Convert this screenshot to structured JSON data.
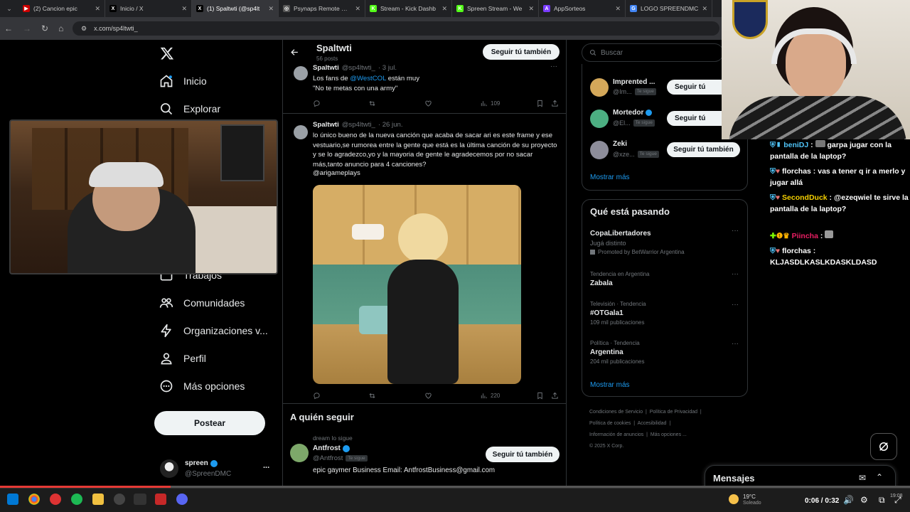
{
  "browser": {
    "tabs": [
      {
        "title": "(2) Cancion epic",
        "color": "#cc0000",
        "glyph": "▶"
      },
      {
        "title": "Inicio / X",
        "color": "#000000",
        "glyph": "X"
      },
      {
        "title": "(1) Spaltwti (@sp4lt",
        "color": "#000000",
        "glyph": "X"
      },
      {
        "title": "Psynaps Remote Con",
        "color": "#555555",
        "glyph": "◎"
      },
      {
        "title": "Stream - Kick Dashb",
        "color": "#53fc18",
        "glyph": "K"
      },
      {
        "title": "Spreen Stream - We",
        "color": "#53fc18",
        "glyph": "K"
      },
      {
        "title": "AppSorteos",
        "color": "#7a3cff",
        "glyph": "A"
      },
      {
        "title": "LOGO SPREENDMC",
        "color": "#4285f4",
        "glyph": "G"
      }
    ],
    "url": "x.com/sp4ltwti_"
  },
  "nav": {
    "items": [
      {
        "label": "Inicio",
        "icon": "home-icon"
      },
      {
        "label": "Explorar",
        "icon": "search-icon"
      },
      {
        "label": "Trabajos",
        "icon": "briefcase-icon"
      },
      {
        "label": "Comunidades",
        "icon": "communities-icon"
      },
      {
        "label": "Organizaciones v...",
        "icon": "lightning-icon"
      },
      {
        "label": "Perfil",
        "icon": "person-icon"
      },
      {
        "label": "Más opciones",
        "icon": "more-circle-icon"
      }
    ],
    "post_label": "Postear",
    "account": {
      "name": "spreen",
      "handle": "@SpreenDMC",
      "more": "..."
    }
  },
  "profile_header": {
    "name": "Spaltwti",
    "posts": "56 posts",
    "follow_label": "Seguir tú también"
  },
  "tweets": [
    {
      "name": "Spaltwti",
      "handle": "@sp4ltwti_",
      "date": "· 3 jul.",
      "text_pre": "Los fans de ",
      "mention": "@WestCOL",
      "text_post": " están muy",
      "text_line2": "\"No te metas con una army\"",
      "views": "109"
    },
    {
      "name": "Spaltwti",
      "handle": "@sp4ltwti_",
      "date": "· 26 jun.",
      "text": "lo único bueno de la nueva canción que acaba de sacar ari es este frame y ese vestuario,se rumorea entre la gente que está es la última canción de su proyecto y se lo agradezco,yo y la mayoria de gente le agradecemos por no sacar más,tanto anuncio para 4 canciones?",
      "mention": "@arigameplays",
      "views": "220"
    }
  ],
  "who_to_follow": {
    "title": "A quién seguir",
    "followed_by": "dream lo sigue",
    "name": "Antfrost",
    "handle": "@Antfrost",
    "badge": "Te sigue",
    "bio": "epic gaymer Business Email: AntfrostBusiness@gmail.com",
    "follow_label": "Seguir tú también"
  },
  "right": {
    "search_placeholder": "Buscar",
    "suggestions": [
      {
        "name": "Imprented ...",
        "handle": "@Im...",
        "badge": "Te sigue",
        "button": "Seguir tú"
      },
      {
        "name": "Mortedor",
        "handle": "@El...",
        "badge": "Te sigue",
        "button": "Seguir tú"
      },
      {
        "name": "Zeki",
        "handle": "@xze...",
        "badge": "Te sigue",
        "button": "Seguir tú también"
      }
    ],
    "show_more": "Mostrar más",
    "trends_title": "Qué está pasando",
    "trends": [
      {
        "meta": "",
        "name": "CopaLibertadores",
        "sub": "Jugá distinto",
        "extra": "Promoted by BetWarrior Argentina"
      },
      {
        "meta": "Tendencia en Argentina",
        "name": "Zabala",
        "sub": "",
        "extra": ""
      },
      {
        "meta": "Televisión · Tendencia",
        "name": "#OTGala1",
        "sub": "109 mil publicaciones",
        "extra": ""
      },
      {
        "meta": "Política · Tendencia",
        "name": "Argentina",
        "sub": "204 mil publicaciones",
        "extra": ""
      }
    ],
    "trends_more": "Mostrar más",
    "footer": [
      "Condiciones de Servicio",
      "Política de Privacidad",
      "Política de cookies",
      "Accesibilidad",
      "Información de anuncios",
      "Más opciones ...",
      "© 2025 X Corp."
    ],
    "messages": "Mensajes"
  },
  "chat": [
    {
      "user": "beniDJ",
      "user_color": "#4fc3f7",
      "text": "garpa jugar con la pantalla de la laptop?"
    },
    {
      "user": "florchas",
      "user_color": "#ffffff",
      "text": "vas a tener q ir a merlo y jugar allá"
    },
    {
      "user": "SecondDuck",
      "user_color": "#f5d000",
      "text": "@ezeqwiel te sirve la pantalla de la laptop?"
    },
    {
      "user": "Piincha",
      "user_color": "#e91e63",
      "text": ""
    },
    {
      "user": "florchas",
      "user_color": "#ffffff",
      "text": "KLJASDLKASLKDASKLDASD"
    }
  ],
  "player": {
    "time": "0:06 / 0:32"
  },
  "taskbar": {
    "weather": "19°C",
    "weather_sub": "Soleado",
    "clock": "19:08"
  }
}
